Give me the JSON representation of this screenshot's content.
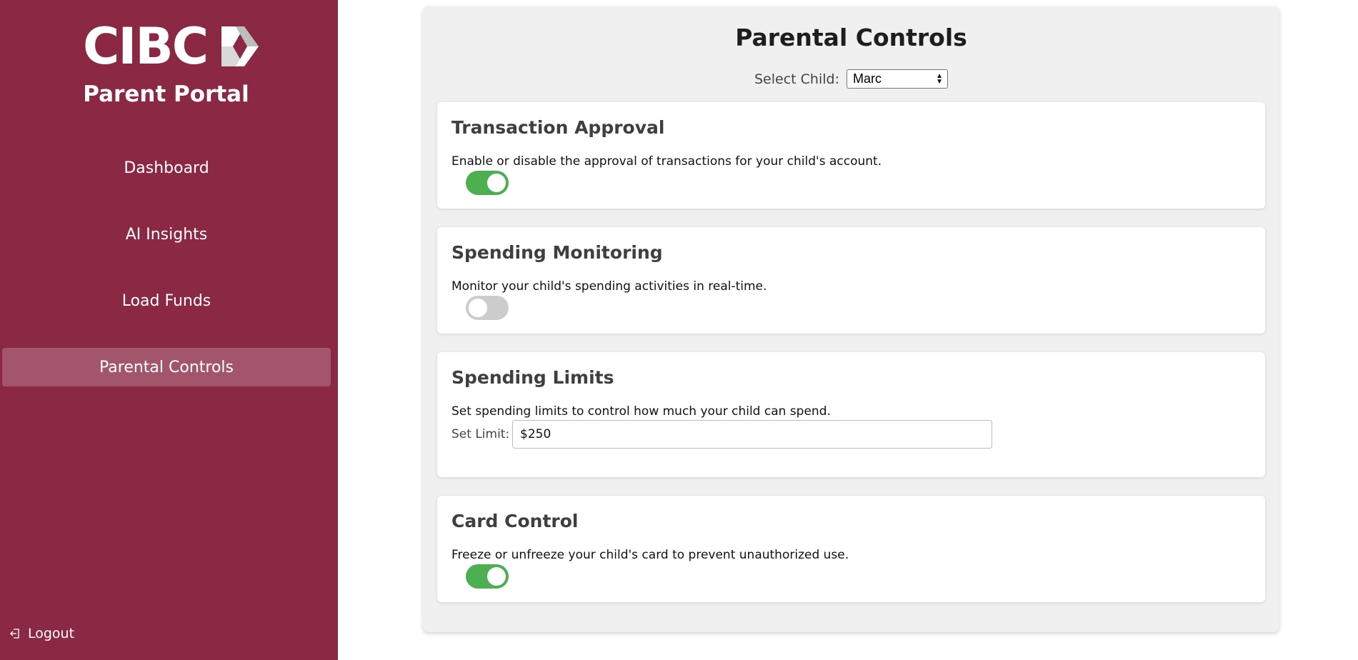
{
  "brand": {
    "logo_text": "CIBC",
    "portal_title": "Parent Portal",
    "colors": {
      "sidebar": "#8b2843",
      "active": "#a3566b",
      "toggle_on": "#4caf50",
      "toggle_off": "#cccccc"
    }
  },
  "sidebar": {
    "items": [
      {
        "label": "Dashboard",
        "active": false
      },
      {
        "label": "AI Insights",
        "active": false
      },
      {
        "label": "Load Funds",
        "active": false
      },
      {
        "label": "Parental Controls",
        "active": true
      }
    ],
    "logout": {
      "label": "Logout",
      "icon": "logout-icon"
    }
  },
  "main": {
    "title": "Parental Controls",
    "select_child": {
      "label": "Select Child:",
      "value": "Marc"
    },
    "sections": {
      "transaction_approval": {
        "title": "Transaction Approval",
        "description": "Enable or disable the approval of transactions for your child's account.",
        "enabled": true
      },
      "spending_monitoring": {
        "title": "Spending Monitoring",
        "description": "Monitor your child's spending activities in real-time.",
        "enabled": false
      },
      "spending_limits": {
        "title": "Spending Limits",
        "description": "Set spending limits to control how much your child can spend.",
        "limit_label": "Set Limit:",
        "limit_value": "$250"
      },
      "card_control": {
        "title": "Card Control",
        "description": "Freeze or unfreeze your child's card to prevent unauthorized use.",
        "enabled": true
      }
    }
  }
}
